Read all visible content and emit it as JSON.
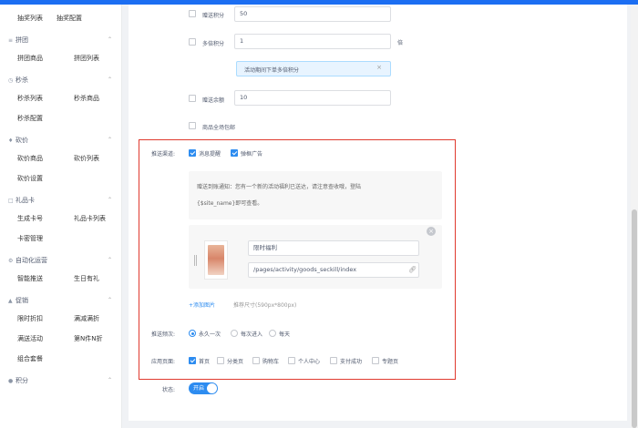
{
  "sidebar": {
    "top_row": [
      "抽奖列表",
      "抽奖配置"
    ],
    "groups": [
      {
        "icon": "team-icon",
        "title": "拼团",
        "rows": [
          [
            "拼团商品",
            "拼团列表"
          ]
        ]
      },
      {
        "icon": "clock-icon",
        "title": "秒杀",
        "rows": [
          [
            "秒杀列表",
            "秒杀商品"
          ],
          [
            "秒杀配置"
          ]
        ]
      },
      {
        "icon": "bargain-icon",
        "title": "砍价",
        "rows": [
          [
            "砍价商品",
            "砍价列表"
          ],
          [
            "砍价设置"
          ]
        ]
      },
      {
        "icon": "gift-card-icon",
        "title": "礼品卡",
        "rows": [
          [
            "生成卡号",
            "礼品卡列表"
          ],
          [
            "卡密管理"
          ]
        ]
      },
      {
        "icon": "automation-icon",
        "title": "自动化运营",
        "rows": [
          [
            "智能推送",
            "生日有礼"
          ]
        ]
      },
      {
        "icon": "promotion-icon",
        "title": "促销",
        "rows": [
          [
            "限时折扣",
            "满减满折"
          ],
          [
            "满送活动",
            "第N件N折"
          ],
          [
            "组合套餐"
          ]
        ]
      },
      {
        "icon": "points-icon",
        "title": "积分",
        "rows": []
      }
    ]
  },
  "form": {
    "gift_points_label": "赠送积分",
    "gift_points_value": "50",
    "multi_points_label": "多倍积分",
    "multi_points_value": "1",
    "multi_points_unit": "倍",
    "notice_text": "活动期间下单多倍积分",
    "notice_close": "×",
    "gift_balance_label": "赠送余额",
    "gift_balance_value": "10",
    "free_shipping_label": "商品全场包邮",
    "push_channel_label": "推送渠道:",
    "channel_message": "消息提醒",
    "channel_popup": "弹框广告",
    "message_line1": "赠送到账通知：您有一个新的活动福利已送达，请注意查收哦，登陆",
    "message_line2": "{$site_name}即可查看。",
    "ad_title_value": "限时福利",
    "ad_link_value": "/pages/activity/goods_seckill/index",
    "add_image_label": "+添加图片",
    "size_hint": "推荐尺寸(590px*800px)",
    "frequency_label": "推送频次:",
    "freq_options": [
      "永久一次",
      "每次进入",
      "每天"
    ],
    "pages_label": "应用页面:",
    "page_options": [
      "首页",
      "分类页",
      "购物车",
      "个人中心",
      "支付成功",
      "专题页"
    ],
    "status_label": "状态:",
    "switch_text": "开启"
  },
  "colors": {
    "accent": "#2d8cf0",
    "highlight_border": "#e03a2f",
    "topbar": "#1c6ef2"
  }
}
